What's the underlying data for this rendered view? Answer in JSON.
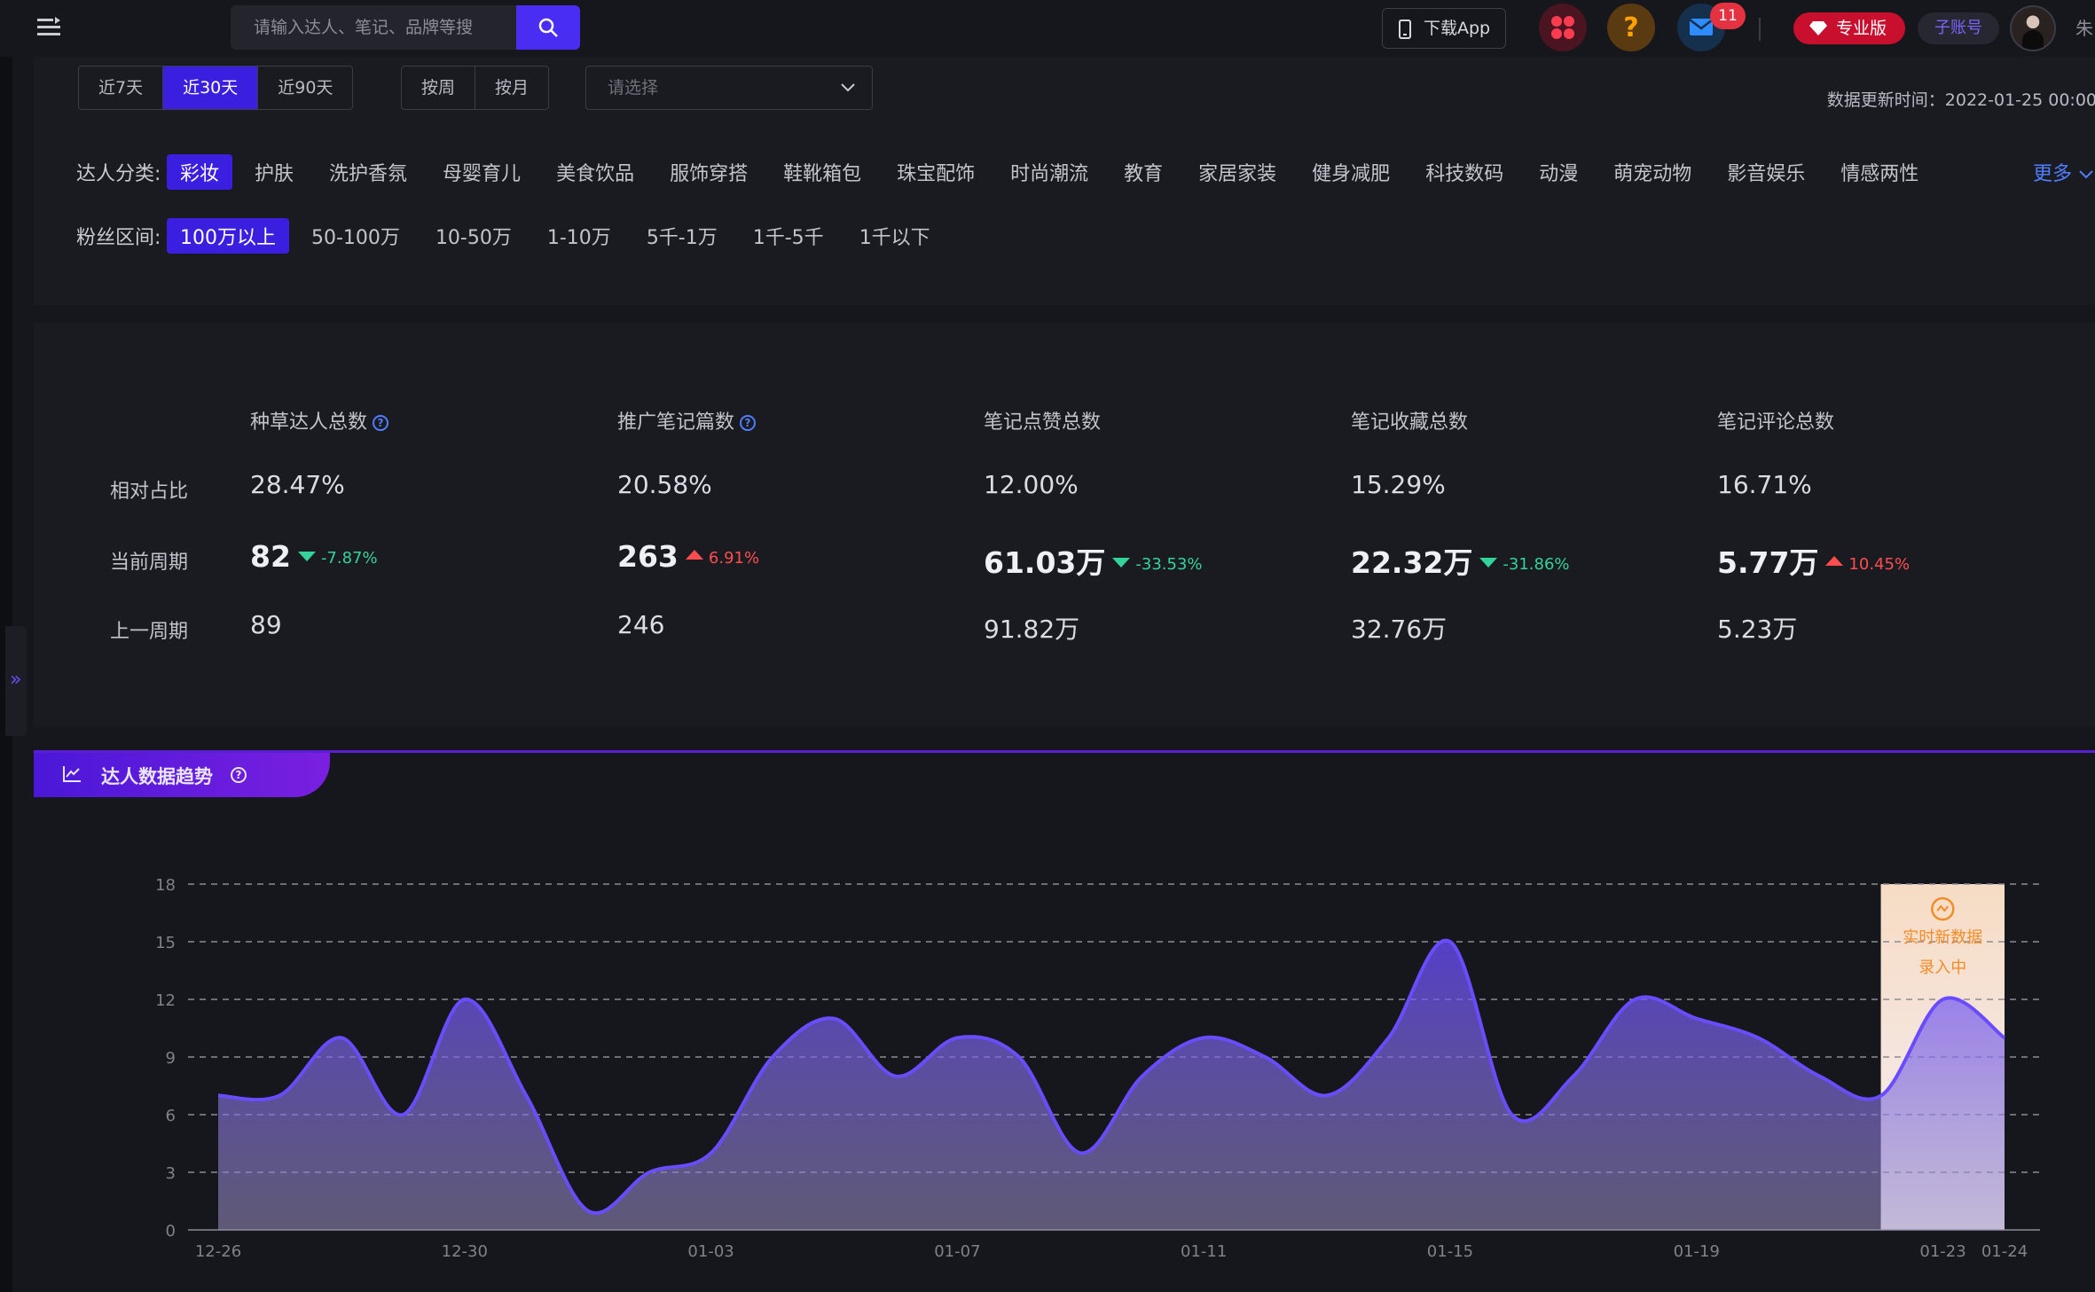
{
  "header": {
    "search_placeholder": "请输入达人、笔记、品牌等搜",
    "download_app": "下载App",
    "mail_badge": "11",
    "pro_label": "专业版",
    "sub_account": "子账号",
    "username": "朱"
  },
  "filters": {
    "period_options": [
      "近7天",
      "近30天",
      "近90天"
    ],
    "period_selected": "近30天",
    "unit_options": [
      "按周",
      "按月"
    ],
    "select_placeholder": "请选择",
    "update_time": "数据更新时间：2022-01-25 00:00",
    "category_label": "达人分类:",
    "categories": [
      "彩妆",
      "护肤",
      "洗护香氛",
      "母婴育儿",
      "美食饮品",
      "服饰穿搭",
      "鞋靴箱包",
      "珠宝配饰",
      "时尚潮流",
      "教育",
      "家居家装",
      "健身减肥",
      "科技数码",
      "动漫",
      "萌宠动物",
      "影音娱乐",
      "情感两性"
    ],
    "category_selected": "彩妆",
    "more_label": "更多",
    "fans_label": "粉丝区间:",
    "fans_ranges": [
      "100万以上",
      "50-100万",
      "10-50万",
      "1-10万",
      "5千-1万",
      "1千-5千",
      "1千以下"
    ],
    "fans_selected": "100万以上"
  },
  "stats": {
    "row_labels": {
      "ratio": "相对占比",
      "current": "当前周期",
      "previous": "上一周期"
    },
    "columns": [
      {
        "title": "种草达人总数",
        "help": true,
        "ratio": "28.47%",
        "current": "82",
        "change": "-7.87%",
        "direction": "down",
        "previous": "89"
      },
      {
        "title": "推广笔记篇数",
        "help": true,
        "ratio": "20.58%",
        "current": "263",
        "change": "6.91%",
        "direction": "up",
        "previous": "246"
      },
      {
        "title": "笔记点赞总数",
        "help": false,
        "ratio": "12.00%",
        "current": "61.03万",
        "change": "-33.53%",
        "direction": "down",
        "previous": "91.82万"
      },
      {
        "title": "笔记收藏总数",
        "help": false,
        "ratio": "15.29%",
        "current": "22.32万",
        "change": "-31.86%",
        "direction": "down",
        "previous": "32.76万"
      },
      {
        "title": "笔记评论总数",
        "help": false,
        "ratio": "16.71%",
        "current": "5.77万",
        "change": "10.45%",
        "direction": "up",
        "previous": "5.23万"
      }
    ]
  },
  "trend": {
    "title": "达人数据趋势",
    "realtime_line1": "实时新数据",
    "realtime_line2": "录入中"
  },
  "colors": {
    "accent": "#3b1fe0",
    "line": "#6a4cff",
    "up": "#ff4d4f",
    "down": "#34d399",
    "link": "#4f7dff"
  },
  "chart_data": {
    "type": "area",
    "x_tick_labels": [
      "12-26",
      "12-30",
      "01-03",
      "01-07",
      "01-11",
      "01-15",
      "01-19",
      "01-23",
      "01-24"
    ],
    "y_ticks": [
      0,
      3,
      6,
      9,
      12,
      15,
      18
    ],
    "ylim": [
      0,
      18
    ],
    "grid": true,
    "x": [
      "12-26",
      "12-27",
      "12-28",
      "12-29",
      "12-30",
      "12-31",
      "01-01",
      "01-02",
      "01-03",
      "01-04",
      "01-05",
      "01-06",
      "01-07",
      "01-08",
      "01-09",
      "01-10",
      "01-11",
      "01-12",
      "01-13",
      "01-14",
      "01-15",
      "01-16",
      "01-17",
      "01-18",
      "01-19",
      "01-20",
      "01-21",
      "01-22",
      "01-23",
      "01-24"
    ],
    "series": [
      {
        "values": [
          7,
          7,
          10,
          6,
          12,
          7,
          1,
          3,
          4,
          9,
          11,
          8,
          10,
          9,
          4,
          8,
          10,
          9,
          7,
          10,
          15,
          6,
          8,
          12,
          11,
          10,
          8,
          7,
          12,
          10
        ]
      }
    ],
    "realtime_highlight": [
      "01-23",
      "01-24"
    ]
  }
}
